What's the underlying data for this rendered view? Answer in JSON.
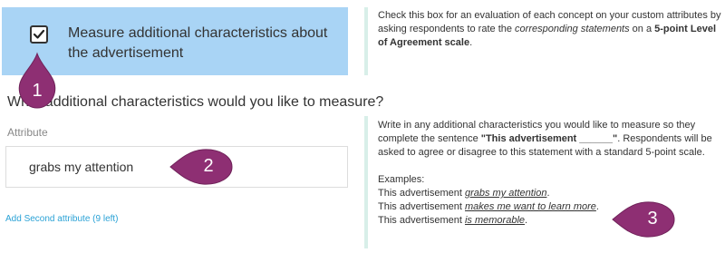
{
  "measure_section": {
    "checkbox_checked": true,
    "checkbox_label": "Measure additional characteristics about the advertisement",
    "help_text": {
      "part1": "Check this box for an evaluation of each concept on your custom attributes by asking respondents to rate the ",
      "emphasis": "corresponding statements",
      "part2": " on a ",
      "bold": "5-point Level of Agreement scale",
      "part3": "."
    }
  },
  "attributes_section": {
    "question": "What additional characteristics would you like to measure?",
    "attribute_label": "Attribute",
    "attribute_value": "grabs my attention",
    "add_link": "Add Second attribute (9 left)",
    "help_text": {
      "part1": "Write in any additional characteristics you would like to measure so they complete the sentence ",
      "bold": "\"This advertisement ______\"",
      "part2": ". Respondents will be asked to agree or disagree to this statement with a standard 5-point scale."
    },
    "examples_heading": "Examples:",
    "examples": [
      {
        "prefix": "This advertisement ",
        "term": "grabs my attention",
        "suffix": "."
      },
      {
        "prefix": "This advertisement ",
        "term": "makes me want to learn more",
        "suffix": "."
      },
      {
        "prefix": "This advertisement ",
        "term": "is memorable",
        "suffix": "."
      }
    ]
  },
  "callouts": {
    "marker_1": "1",
    "marker_2": "2",
    "marker_3": "3",
    "color": "#8e2f73"
  },
  "colors": {
    "panel_bg": "#a9d4f5",
    "divider": "#d8efe9",
    "link": "#2aa2d6"
  }
}
